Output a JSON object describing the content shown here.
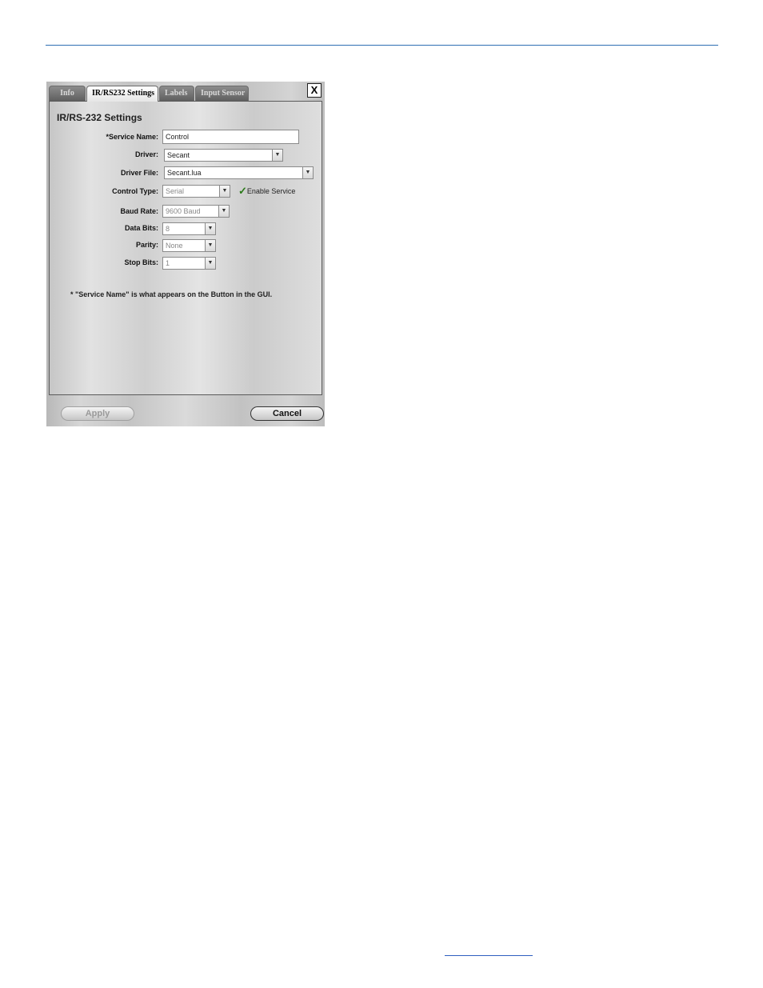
{
  "tabs": [
    {
      "label": "Info"
    },
    {
      "label": "IR/RS232 Settings"
    },
    {
      "label": "Labels"
    },
    {
      "label": "Input Sensor"
    }
  ],
  "close_label": "X",
  "panel_title": "IR/RS-232 Settings",
  "fields": {
    "service_name": {
      "label": "*Service Name:",
      "value": "Control"
    },
    "driver": {
      "label": "Driver:",
      "value": "Secant"
    },
    "driver_file": {
      "label": "Driver File:",
      "value": "Secant.lua"
    },
    "control_type": {
      "label": "Control Type:",
      "value": "Serial"
    },
    "baud_rate": {
      "label": "Baud Rate:",
      "value": "9600 Baud"
    },
    "data_bits": {
      "label": "Data Bits:",
      "value": "8"
    },
    "parity": {
      "label": "Parity:",
      "value": "None"
    },
    "stop_bits": {
      "label": "Stop Bits:",
      "value": "1"
    }
  },
  "enable_service": {
    "label": "Enable Service",
    "checked": true
  },
  "note": "* \"Service Name\" is what appears on the Button in the GUI.",
  "buttons": {
    "apply": "Apply",
    "cancel": "Cancel"
  },
  "colors": {
    "accent_rule": "#2f6fb3",
    "check": "#2b7a19"
  }
}
